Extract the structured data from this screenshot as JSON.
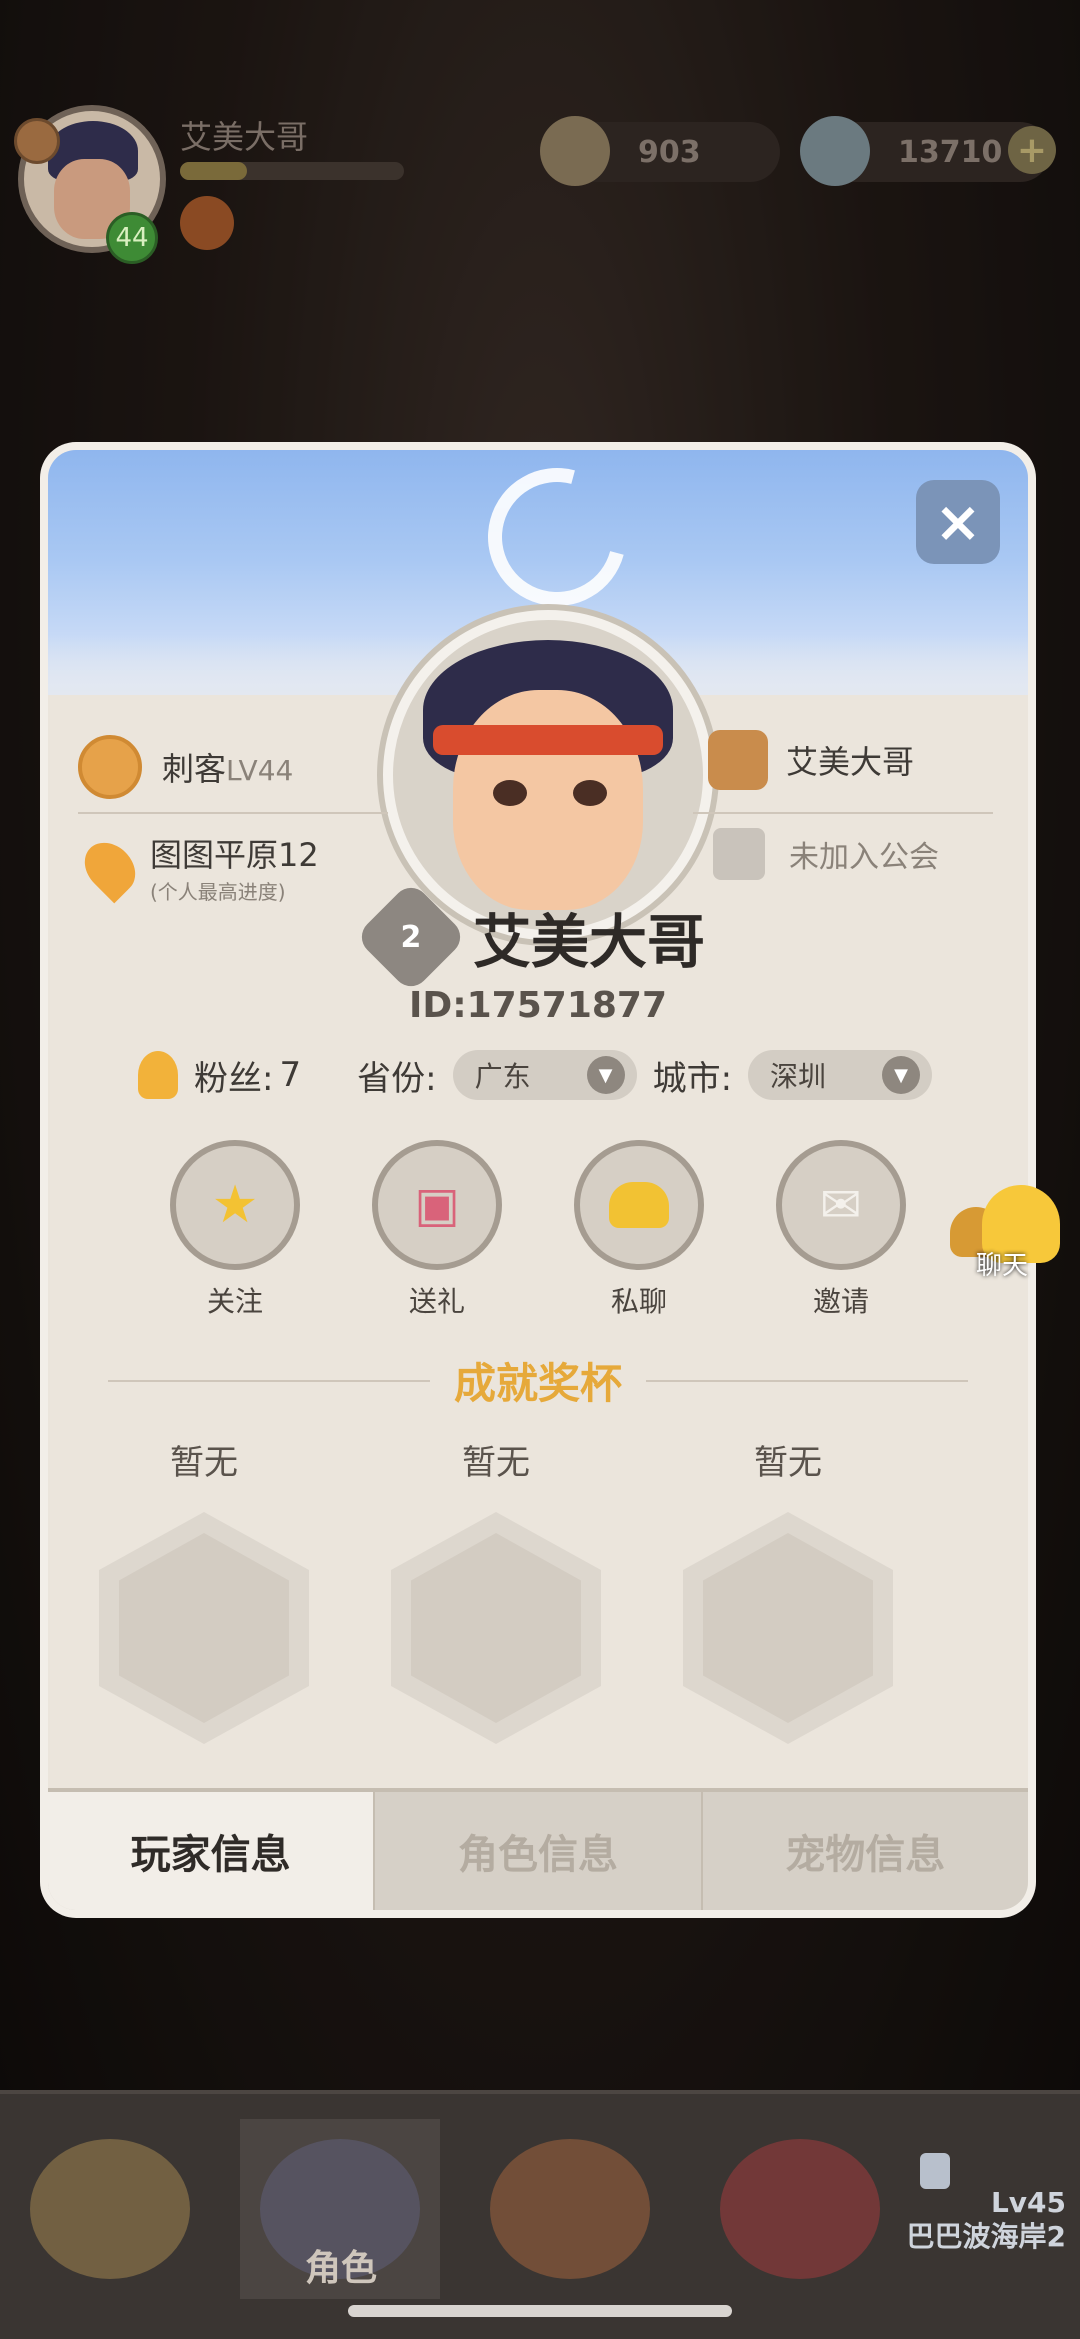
{
  "hud": {
    "player_name": "艾美大哥",
    "level": "44",
    "exp_progress": 0.3,
    "shells": "903",
    "pearls": "13710",
    "plus": "+"
  },
  "dialog": {
    "close": "×",
    "class_label": "刺客",
    "class_level": "LV44",
    "map_label": "图图平原12",
    "map_sub": "(个人最高进度)",
    "partner_name": "艾美大哥",
    "guild_status": "未加入公会",
    "rank_number": "2",
    "name": "艾美大哥",
    "id": "ID:17571877",
    "fans_label": "粉丝:",
    "fans_count": "7",
    "province_label": "省份:",
    "province_value": "广东",
    "city_label": "城市:",
    "city_value": "深圳",
    "actions": [
      {
        "label": "关注",
        "icon": "star-icon"
      },
      {
        "label": "送礼",
        "icon": "gift-icon"
      },
      {
        "label": "私聊",
        "icon": "chat-icon"
      },
      {
        "label": "邀请",
        "icon": "envelope-icon"
      }
    ],
    "section_title": "成就奖杯",
    "trophies": [
      {
        "label": "暂无"
      },
      {
        "label": "暂无"
      },
      {
        "label": "暂无"
      }
    ],
    "tabs": [
      {
        "label": "玩家信息",
        "active": true
      },
      {
        "label": "角色信息",
        "active": false
      },
      {
        "label": "宠物信息",
        "active": false
      }
    ]
  },
  "chat_float": {
    "label": "聊天"
  },
  "bottom_nav": {
    "role_label": "角色",
    "locked_level": "Lv45",
    "locked_area": "巴巴波海岸2"
  },
  "colors": {
    "accent_gold": "#e6a93a",
    "panel": "#ebe5dc",
    "active_tab": "#f2eee8"
  }
}
